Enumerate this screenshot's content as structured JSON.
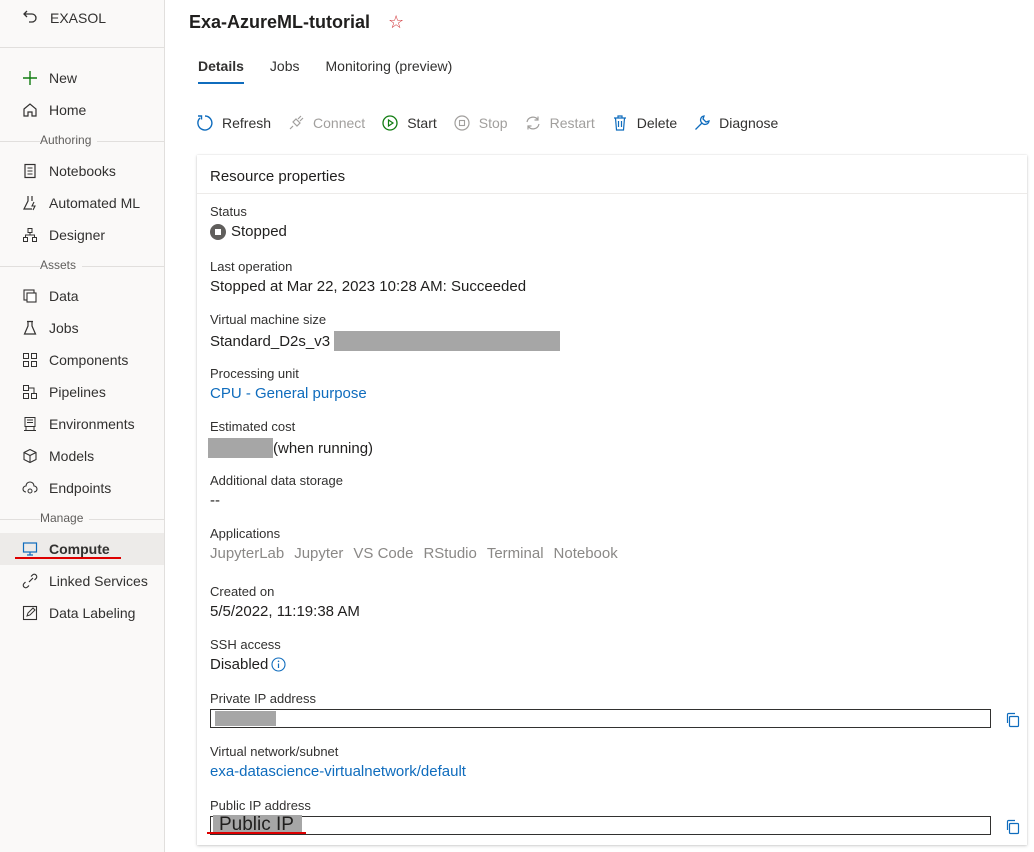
{
  "sidebar": {
    "workspace": "EXASOL",
    "new_label": "New",
    "home_label": "Home",
    "section_authoring": "Authoring",
    "notebooks": "Notebooks",
    "automated_ml": "Automated ML",
    "designer": "Designer",
    "section_assets": "Assets",
    "data": "Data",
    "jobs": "Jobs",
    "components": "Components",
    "pipelines": "Pipelines",
    "environments": "Environments",
    "models": "Models",
    "endpoints": "Endpoints",
    "section_manage": "Manage",
    "compute": "Compute",
    "linked_services": "Linked Services",
    "data_labeling": "Data Labeling"
  },
  "header": {
    "title": "Exa-AzureML-tutorial",
    "star": "☆"
  },
  "tabs": {
    "details": "Details",
    "jobs": "Jobs",
    "monitoring": "Monitoring (preview)"
  },
  "toolbar": {
    "refresh": "Refresh",
    "connect": "Connect",
    "start": "Start",
    "stop": "Stop",
    "restart": "Restart",
    "delete": "Delete",
    "diagnose": "Diagnose"
  },
  "card": {
    "title": "Resource properties",
    "status_label": "Status",
    "status_value": "Stopped",
    "last_op_label": "Last operation",
    "last_op_value": "Stopped at Mar 22, 2023 10:28 AM: Succeeded",
    "vm_size_label": "Virtual machine size",
    "vm_size_value": "Standard_D2s_v3",
    "proc_label": "Processing unit",
    "proc_value": "CPU - General purpose",
    "cost_label": "Estimated cost",
    "cost_value": "(when running)",
    "storage_label": "Additional data storage",
    "storage_value": "--",
    "apps_label": "Applications",
    "apps": [
      "JupyterLab",
      "Jupyter",
      "VS Code",
      "RStudio",
      "Terminal",
      "Notebook"
    ],
    "created_label": "Created on",
    "created_value": "5/5/2022, 11:19:38 AM",
    "ssh_label": "SSH access",
    "ssh_value": "Disabled",
    "private_ip_label": "Private IP address",
    "vnet_label": "Virtual network/subnet",
    "vnet_value": "exa-datascience-virtualnetwork/default",
    "public_ip_label": "Public IP address",
    "public_ip_value": "Public IP"
  },
  "colors": {
    "accent": "#0f6cbd",
    "annotation_red": "#dd0000",
    "redaction_gray": "#a6a6a6"
  }
}
